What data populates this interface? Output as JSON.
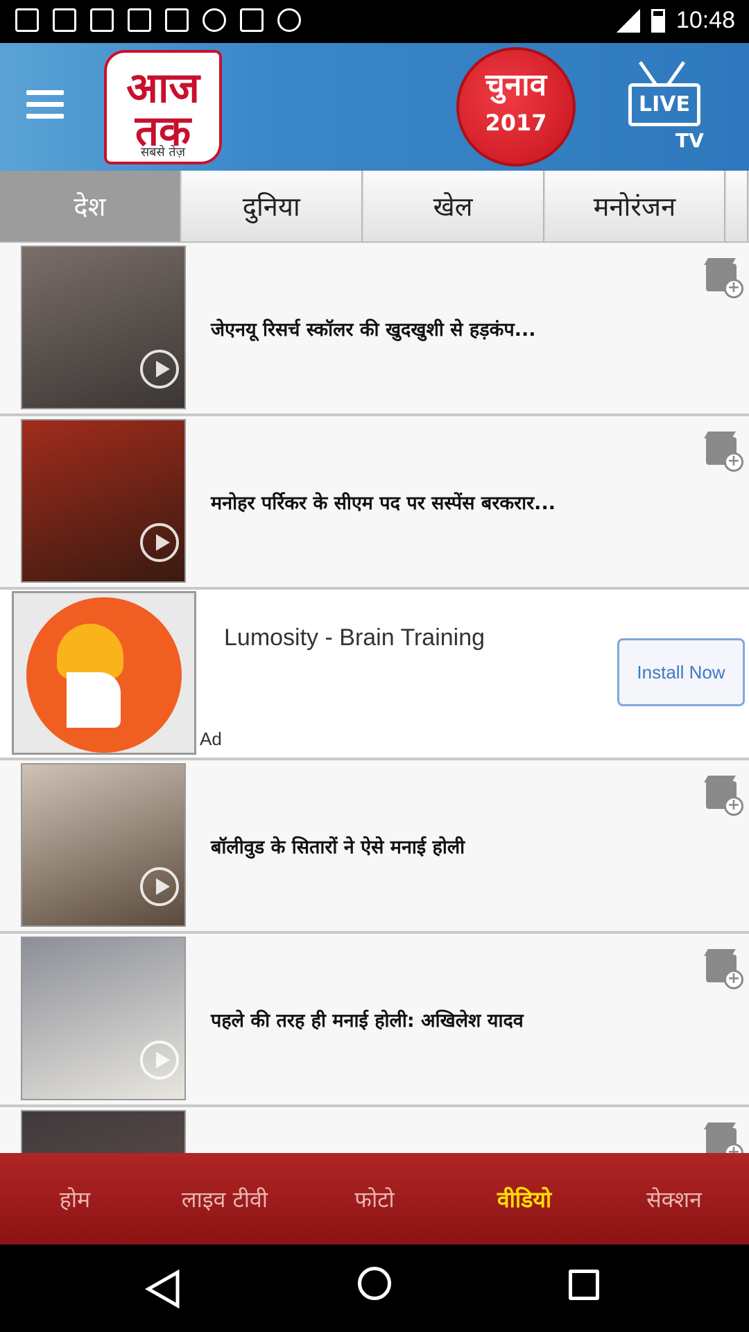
{
  "status_bar": {
    "time": "10:48",
    "left_icons": [
      "facebook-icon",
      "facebook-icon",
      "facebook-icon",
      "gallery-icon",
      "fake-gps-icon",
      "sync-icon",
      "lock-icon",
      "android-icon"
    ],
    "right_icons": [
      "signal-icon",
      "battery-icon"
    ]
  },
  "header": {
    "logo_text": "आज तक",
    "logo_tagline": "सबसे तेज़",
    "chunav_text": "चुनाव",
    "chunav_year": "2017",
    "live_label": "LIVE",
    "tv_label": "TV",
    "colors": {
      "header_bg": "#2f78bd",
      "brand_red": "#c8102e"
    }
  },
  "tabs": [
    {
      "label": "देश",
      "active": true
    },
    {
      "label": "दुनिया",
      "active": false
    },
    {
      "label": "खेल",
      "active": false
    },
    {
      "label": "मनोरंजन",
      "active": false
    }
  ],
  "videos": [
    {
      "title": "जेएनयू रिसर्च स्कॉलर की खुदखुशी से हड़कंप..."
    },
    {
      "title": "मनोहर पर्रिकर के सीएम पद पर सस्पेंस बरकरार..."
    },
    {
      "title": "बॉलीवुड के सितारों ने ऐसे मनाई होली"
    },
    {
      "title": "पहले की तरह ही मनाई होली: अखिलेश यादव"
    },
    {
      "title": ""
    }
  ],
  "ad": {
    "title": "Lumosity - Brain Training",
    "label": "Ad",
    "button": "Install Now",
    "colors": {
      "icon_bg": "#f15e22",
      "button_text": "#3f79c6"
    }
  },
  "bottom_nav": [
    {
      "label": "होम",
      "active": false
    },
    {
      "label": "लाइव  टीवी",
      "active": false
    },
    {
      "label": "फोटो",
      "active": false
    },
    {
      "label": "वीडियो",
      "active": true
    },
    {
      "label": "सेक्शन",
      "active": false
    }
  ],
  "bottom_nav_colors": {
    "bg": "#a02020",
    "active": "#ffdd00"
  },
  "system_nav": [
    "back-icon",
    "home-icon",
    "recents-icon"
  ]
}
